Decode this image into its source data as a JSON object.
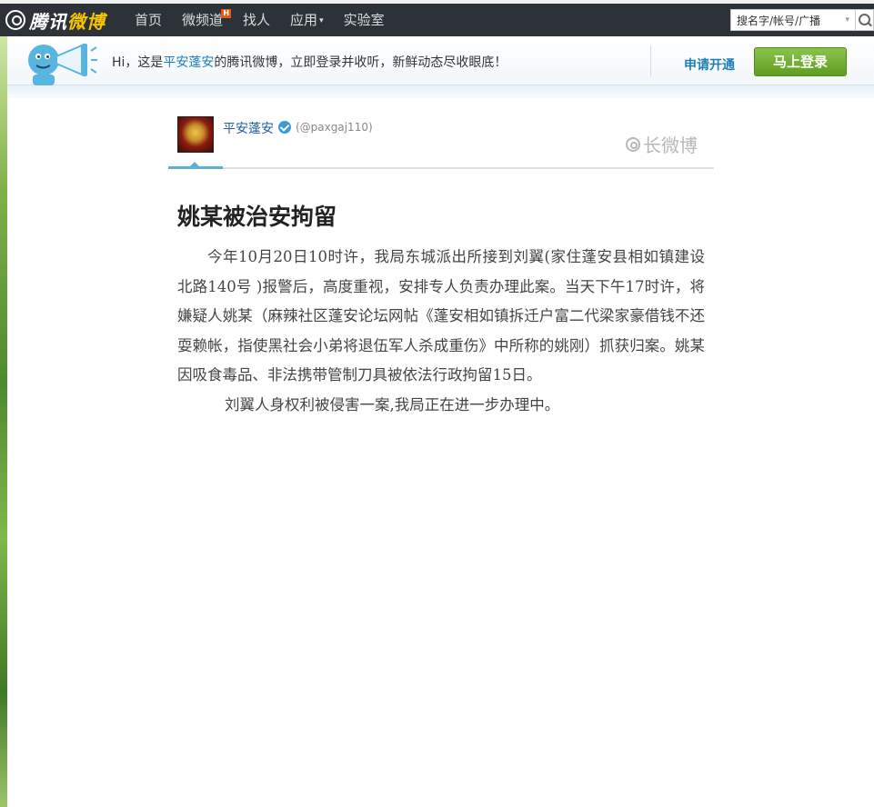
{
  "topbar": {
    "logo_text_a": "腾讯",
    "logo_text_b": "微博",
    "nav": [
      {
        "label": "首页"
      },
      {
        "label": "微频道",
        "badge": "H"
      },
      {
        "label": "找人"
      },
      {
        "label": "应用"
      },
      {
        "label": "实验室"
      }
    ],
    "search_placeholder": "搜名字/帐号/广播"
  },
  "banner": {
    "greeting_pre": "Hi，这是",
    "greeting_user": "平安蓬安",
    "greeting_post": "的腾讯微博，立即登录并收听，新鲜动态尽收眼底！",
    "apply_label": "申请开通",
    "login_label": "马上登录"
  },
  "article": {
    "author_name": "平安蓬安",
    "author_handle": "(@paxgaj110)",
    "longweibo_label": "长微博",
    "title": "姚某被治安拘留",
    "paragraph_1": "今年10月20日10时许，我局东城派出所接到刘翼(家住蓬安县相如镇建设北路140号 )报警后，高度重视，安排专人负责办理此案。当天下午17时许，将嫌疑人姚某（麻辣社区蓬安论坛网帖《蓬安相如镇拆迁户富二代梁家豪借钱不还耍赖帐，指使黑社会小弟将退伍军人杀成重伤》中所称的姚刚）抓获归案。姚某因吸食毒品、非法携带管制刀具被依法行政拘留15日。",
    "paragraph_2": "刘翼人身权利被侵害一案,我局正在进一步办理中。"
  },
  "colors": {
    "topbar_bg": "#2c3238",
    "link_blue": "#1e7fb4",
    "login_green": "#6aab2a",
    "accent_blue": "#5aaee0"
  }
}
